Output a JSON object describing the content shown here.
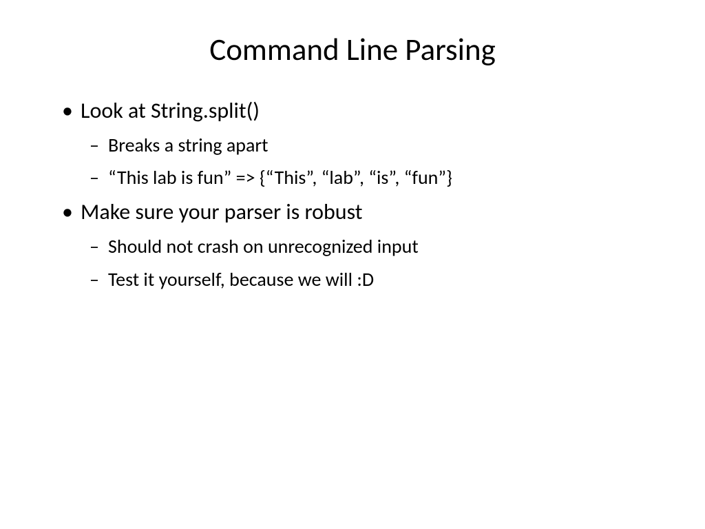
{
  "slide": {
    "title": "Command Line Parsing",
    "bullets": [
      {
        "text": "Look at String.split()",
        "children": [
          "Breaks a string apart",
          "“This lab is fun” => {“This”, “lab”, “is”, “fun”}"
        ]
      },
      {
        "text": "Make sure your parser is robust",
        "children": [
          "Should not crash on unrecognized input",
          "Test it yourself, because we will :D"
        ]
      }
    ]
  }
}
